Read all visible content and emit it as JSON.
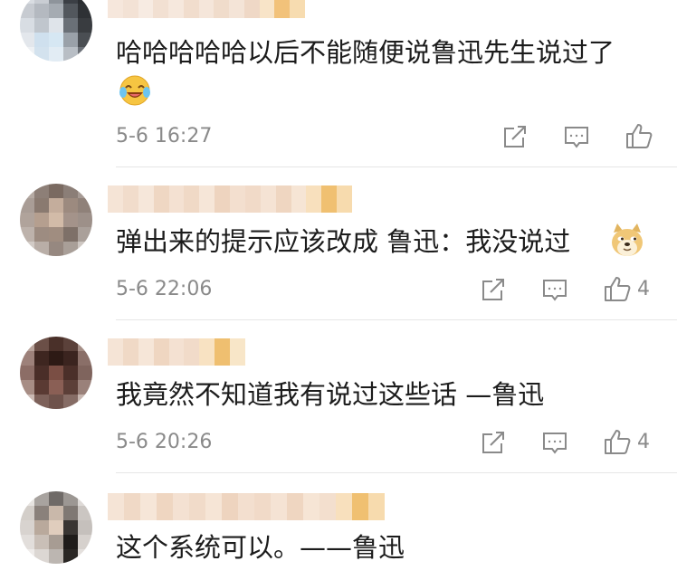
{
  "comments": [
    {
      "text": "哈哈哈哈哈以后不能随便说鲁迅先生说过了",
      "emoji": "laughing-tears-emoji",
      "time": "5-6 16:27",
      "likes": ""
    },
    {
      "text": "弹出来的提示应该改成 鲁迅：我没说过",
      "emoji": "doge-emoji",
      "time": "5-6 22:06",
      "likes": "4"
    },
    {
      "text": "我竟然不知道我有说过这些话 —鲁迅",
      "emoji": "",
      "time": "5-6 20:26",
      "likes": "4"
    },
    {
      "text": "这个系统可以。——鲁迅",
      "emoji": "",
      "time": "",
      "likes": ""
    }
  ],
  "icons": {
    "share": "share-icon",
    "comment": "comment-icon",
    "like": "thumbs-up-icon"
  },
  "colors": {
    "text": "#1c1c1c",
    "meta": "#8a8a8a",
    "divider": "#e6e6e6"
  }
}
